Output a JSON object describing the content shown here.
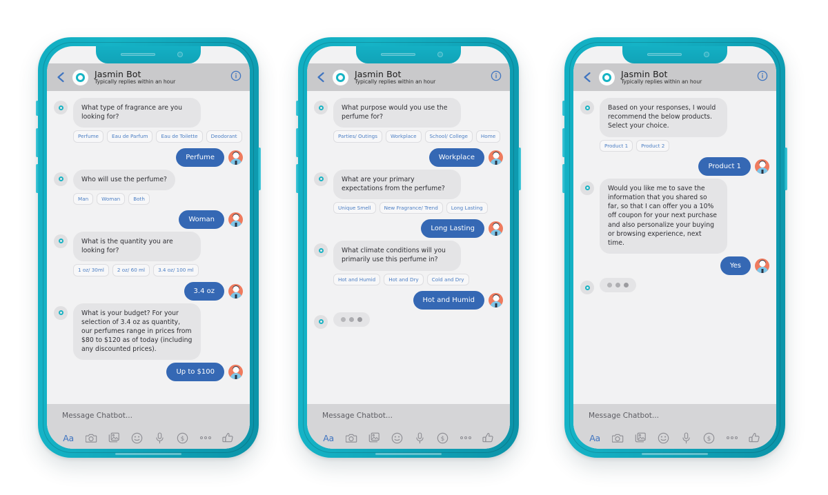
{
  "colors": {
    "frame_teal": "#13aec2",
    "accent_brand": "#16b4c4",
    "user_bubble": "#3568b4",
    "bot_bubble": "#e4e4e6",
    "chip_text": "#4b7ec4",
    "header_bar": "#c9c9cb",
    "composer_bar": "#d5d5d7",
    "screen_bg": "#f2f2f3",
    "avatar_user_bg": "#ef7b5e"
  },
  "header": {
    "title": "Jasmin Bot",
    "subtitle": "Typically replies within an hour",
    "back_icon": "chevron-left-icon",
    "info_icon": "info-circle-icon",
    "avatar_icon": "bot-ring-avatar"
  },
  "composer": {
    "placeholder": "Message Chatbot...",
    "value": "",
    "tools": [
      {
        "name": "text-format-tool",
        "label": "Aa"
      },
      {
        "name": "camera-tool",
        "label": "camera-icon"
      },
      {
        "name": "gallery-tool",
        "label": "photo-library-icon"
      },
      {
        "name": "sticker-tool",
        "label": "smiley-icon"
      },
      {
        "name": "voice-tool",
        "label": "microphone-icon"
      },
      {
        "name": "payment-tool",
        "label": "dollar-circle-icon"
      },
      {
        "name": "more-tool",
        "label": "ellipsis-icon"
      },
      {
        "name": "like-tool",
        "label": "thumbs-up-icon"
      }
    ]
  },
  "phones": [
    {
      "id": "phone-1",
      "messages": [
        {
          "type": "bot",
          "text": "What type of fragrance are you looking for?"
        },
        {
          "type": "chips",
          "options": [
            "Perfume",
            "Eau de Parfum",
            "Eau de Toilette",
            "Deodorant"
          ]
        },
        {
          "type": "user",
          "text": "Perfume"
        },
        {
          "type": "bot",
          "text": "Who will use the perfume?"
        },
        {
          "type": "chips",
          "options": [
            "Man",
            "Woman",
            "Both"
          ]
        },
        {
          "type": "user",
          "text": "Woman"
        },
        {
          "type": "bot",
          "text": "What is the quantity you are looking for?"
        },
        {
          "type": "chips",
          "options": [
            "1 oz/ 30ml",
            "2 oz/ 60 ml",
            "3.4 oz/ 100 ml"
          ]
        },
        {
          "type": "user",
          "text": "3.4 oz"
        },
        {
          "type": "bot",
          "text": "What is your budget? For your selection of 3.4 oz as quantity, our perfumes range in prices from $80 to $120 as of today (including any discounted prices)."
        },
        {
          "type": "user",
          "text": "Up to $100"
        }
      ]
    },
    {
      "id": "phone-2",
      "messages": [
        {
          "type": "bot",
          "text": "What purpose would you use the perfume for?"
        },
        {
          "type": "chips",
          "options": [
            "Parties/ Outings",
            "Workplace",
            "School/ College",
            "Home"
          ]
        },
        {
          "type": "user",
          "text": "Workplace"
        },
        {
          "type": "bot",
          "text": "What are your primary expectations from the perfume?"
        },
        {
          "type": "chips",
          "options": [
            "Unique Smell",
            "New Fragrance/ Trend",
            "Long Lasting"
          ]
        },
        {
          "type": "user",
          "text": "Long Lasting"
        },
        {
          "type": "bot",
          "text": "What climate conditions will you primarily use this perfume in?"
        },
        {
          "type": "chips",
          "options": [
            "Hot and Humid",
            "Hot and Dry",
            "Cold and Dry"
          ]
        },
        {
          "type": "user",
          "text": "Hot and Humid"
        },
        {
          "type": "typing"
        }
      ]
    },
    {
      "id": "phone-3",
      "messages": [
        {
          "type": "bot",
          "text": "Based on your responses, I would recommend the below products. Select your choice."
        },
        {
          "type": "chips",
          "options": [
            "Product 1",
            "Product 2"
          ]
        },
        {
          "type": "user",
          "text": "Product 1"
        },
        {
          "type": "bot",
          "text": "Would you like me to save the information that you shared so far, so that I can offer you a 10% off coupon for your next purchase and also personalize your buying or browsing experience, next time."
        },
        {
          "type": "user",
          "text": "Yes"
        },
        {
          "type": "typing"
        }
      ]
    }
  ]
}
